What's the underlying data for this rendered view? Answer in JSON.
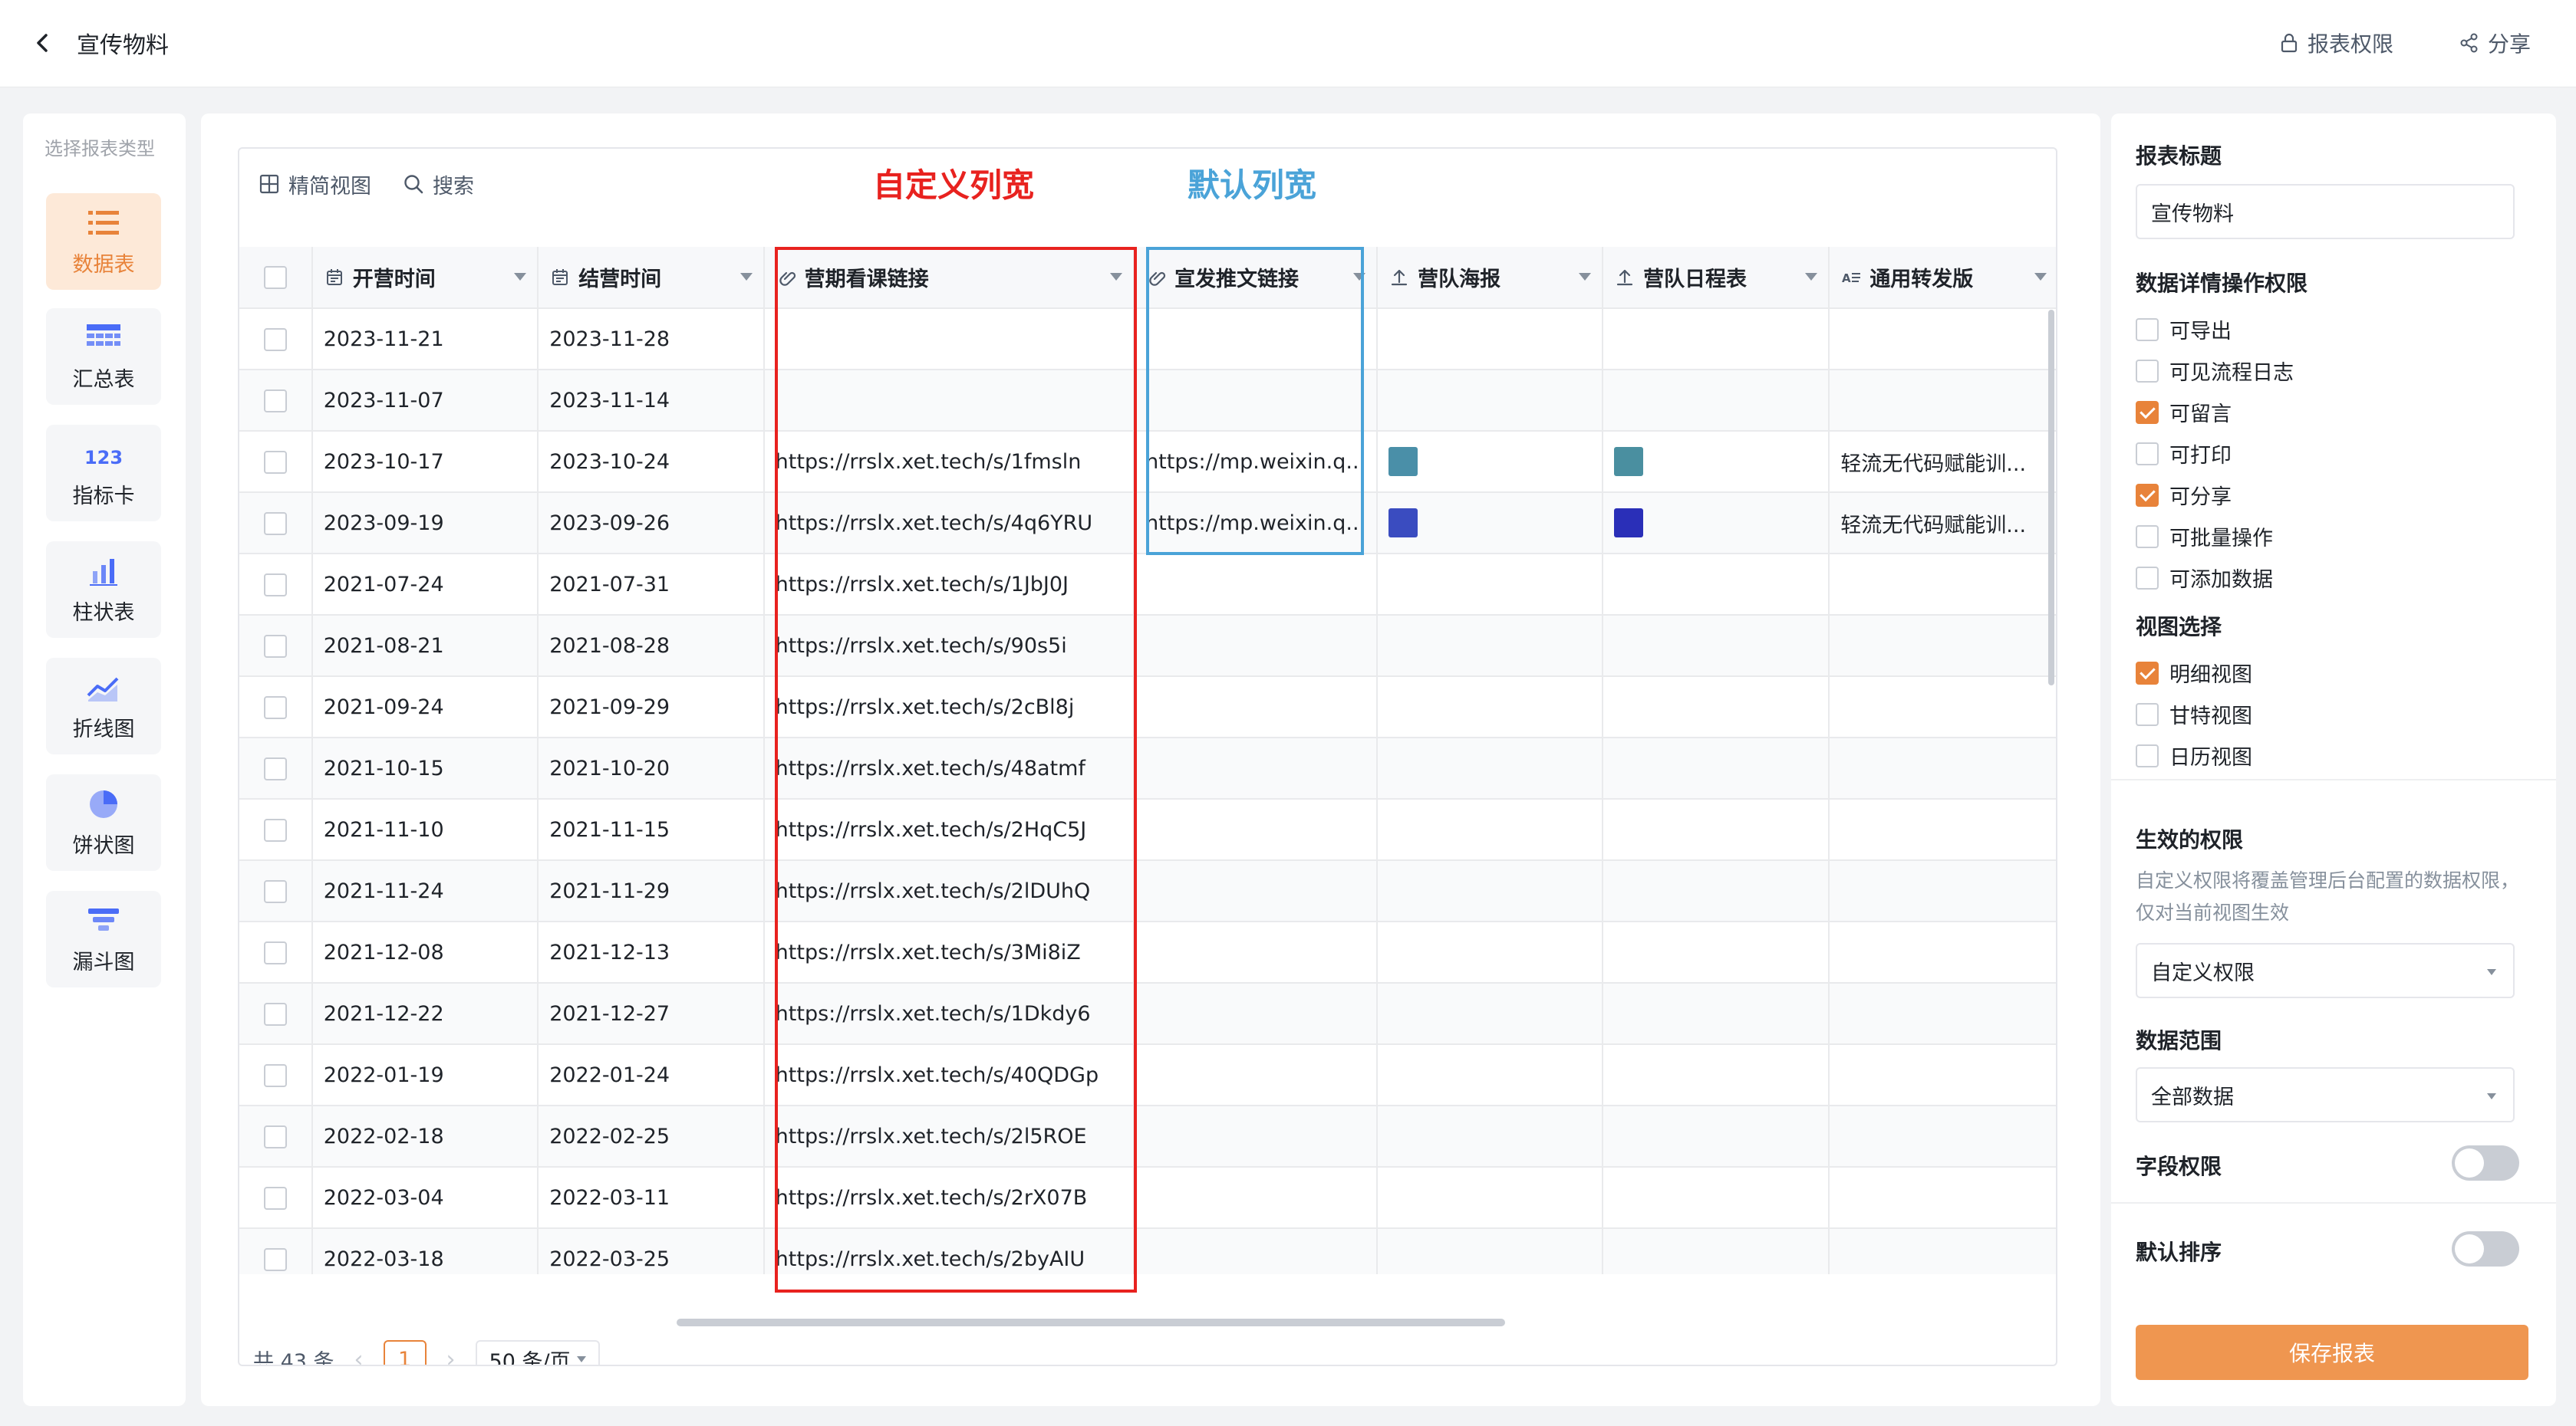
{
  "header": {
    "title": "宣传物料",
    "report_permission_label": "报表权限",
    "share_label": "分享"
  },
  "left_panel": {
    "title": "选择报表类型",
    "items": [
      {
        "label": "数据表",
        "icon": "list-icon",
        "active": true
      },
      {
        "label": "汇总表",
        "icon": "summary-table-icon",
        "active": false
      },
      {
        "label": "指标卡",
        "icon": "metric-card-icon",
        "active": false
      },
      {
        "label": "柱状表",
        "icon": "bar-chart-icon",
        "active": false
      },
      {
        "label": "折线图",
        "icon": "line-chart-icon",
        "active": false
      },
      {
        "label": "饼状图",
        "icon": "pie-chart-icon",
        "active": false
      },
      {
        "label": "漏斗图",
        "icon": "funnel-chart-icon",
        "active": false
      }
    ]
  },
  "toolbar": {
    "simple_view_label": "精简视图",
    "search_label": "搜索"
  },
  "annotations": {
    "custom_width": "自定义列宽",
    "default_width": "默认列宽"
  },
  "table": {
    "columns": [
      {
        "label": "开营时间",
        "icon": "date-icon"
      },
      {
        "label": "结营时间",
        "icon": "date-icon"
      },
      {
        "label": "营期看课链接",
        "icon": "link-icon"
      },
      {
        "label": "宣发推文链接",
        "icon": "link-icon"
      },
      {
        "label": "营队海报",
        "icon": "upload-icon"
      },
      {
        "label": "营队日程表",
        "icon": "upload-icon"
      },
      {
        "label": "通用转发版",
        "icon": "text-icon"
      }
    ],
    "rows": [
      {
        "start": "2023-11-21",
        "end": "2023-11-28",
        "course_link": "",
        "article_link": "",
        "poster": "",
        "schedule": "",
        "forward": ""
      },
      {
        "start": "2023-11-07",
        "end": "2023-11-14",
        "course_link": "",
        "article_link": "",
        "poster": "",
        "schedule": "",
        "forward": ""
      },
      {
        "start": "2023-10-17",
        "end": "2023-10-24",
        "course_link": "https://rrslx.xet.tech/s/1fmsln",
        "article_link": "https://mp.weixin.q...",
        "poster": "#4a8fa8",
        "schedule": "#4a8fa0",
        "forward": "轻流无代码赋能训..."
      },
      {
        "start": "2023-09-19",
        "end": "2023-09-26",
        "course_link": "https://rrslx.xet.tech/s/4q6YRU",
        "article_link": "https://mp.weixin.q...",
        "poster": "#3a4cc0",
        "schedule": "#2a2fb8",
        "forward": "轻流无代码赋能训..."
      },
      {
        "start": "2021-07-24",
        "end": "2021-07-31",
        "course_link": "https://rrslx.xet.tech/s/1JbJ0J",
        "article_link": "",
        "poster": "",
        "schedule": "",
        "forward": ""
      },
      {
        "start": "2021-08-21",
        "end": "2021-08-28",
        "course_link": "https://rrslx.xet.tech/s/90s5i",
        "article_link": "",
        "poster": "",
        "schedule": "",
        "forward": ""
      },
      {
        "start": "2021-09-24",
        "end": "2021-09-29",
        "course_link": "https://rrslx.xet.tech/s/2cBl8j",
        "article_link": "",
        "poster": "",
        "schedule": "",
        "forward": ""
      },
      {
        "start": "2021-10-15",
        "end": "2021-10-20",
        "course_link": "https://rrslx.xet.tech/s/48atmf",
        "article_link": "",
        "poster": "",
        "schedule": "",
        "forward": ""
      },
      {
        "start": "2021-11-10",
        "end": "2021-11-15",
        "course_link": "https://rrslx.xet.tech/s/2HqC5J",
        "article_link": "",
        "poster": "",
        "schedule": "",
        "forward": ""
      },
      {
        "start": "2021-11-24",
        "end": "2021-11-29",
        "course_link": "https://rrslx.xet.tech/s/2lDUhQ",
        "article_link": "",
        "poster": "",
        "schedule": "",
        "forward": ""
      },
      {
        "start": "2021-12-08",
        "end": "2021-12-13",
        "course_link": "https://rrslx.xet.tech/s/3Mi8iZ",
        "article_link": "",
        "poster": "",
        "schedule": "",
        "forward": ""
      },
      {
        "start": "2021-12-22",
        "end": "2021-12-27",
        "course_link": "https://rrslx.xet.tech/s/1Dkdy6",
        "article_link": "",
        "poster": "",
        "schedule": "",
        "forward": ""
      },
      {
        "start": "2022-01-19",
        "end": "2022-01-24",
        "course_link": "https://rrslx.xet.tech/s/40QDGp",
        "article_link": "",
        "poster": "",
        "schedule": "",
        "forward": ""
      },
      {
        "start": "2022-02-18",
        "end": "2022-02-25",
        "course_link": "https://rrslx.xet.tech/s/2l5ROE",
        "article_link": "",
        "poster": "",
        "schedule": "",
        "forward": ""
      },
      {
        "start": "2022-03-04",
        "end": "2022-03-11",
        "course_link": "https://rrslx.xet.tech/s/2rX07B",
        "article_link": "",
        "poster": "",
        "schedule": "",
        "forward": ""
      },
      {
        "start": "2022-03-18",
        "end": "2022-03-25",
        "course_link": "https://rrslx.xet.tech/s/2byAIU",
        "article_link": "",
        "poster": "",
        "schedule": "",
        "forward": ""
      }
    ]
  },
  "pagination": {
    "total_label": "共 43 条",
    "current_page": "1",
    "page_size_label": "50 条/页"
  },
  "right_panel": {
    "report_title_label": "报表标题",
    "report_title_value": "宣传物料",
    "detail_permissions_label": "数据详情操作权限",
    "detail_permissions": [
      {
        "label": "可导出",
        "checked": false
      },
      {
        "label": "可见流程日志",
        "checked": false
      },
      {
        "label": "可留言",
        "checked": true
      },
      {
        "label": "可打印",
        "checked": false
      },
      {
        "label": "可分享",
        "checked": true
      },
      {
        "label": "可批量操作",
        "checked": false
      },
      {
        "label": "可添加数据",
        "checked": false
      }
    ],
    "view_select_label": "视图选择",
    "views": [
      {
        "label": "明细视图",
        "checked": true
      },
      {
        "label": "甘特视图",
        "checked": false
      },
      {
        "label": "日历视图",
        "checked": false
      }
    ],
    "effective_permission_label": "生效的权限",
    "effective_permission_desc": "自定义权限将覆盖管理后台配置的数据权限，仅对当前视图生效",
    "effective_permission_value": "自定义权限",
    "data_range_label": "数据范围",
    "data_range_value": "全部数据",
    "field_permission_label": "字段权限",
    "field_permission_on": false,
    "default_sort_label": "默认排序",
    "default_sort_on": false,
    "save_label": "保存报表"
  },
  "colors": {
    "accent": "#e8833a",
    "custom_box": "#e8221f",
    "default_box": "#4aa3d8"
  }
}
